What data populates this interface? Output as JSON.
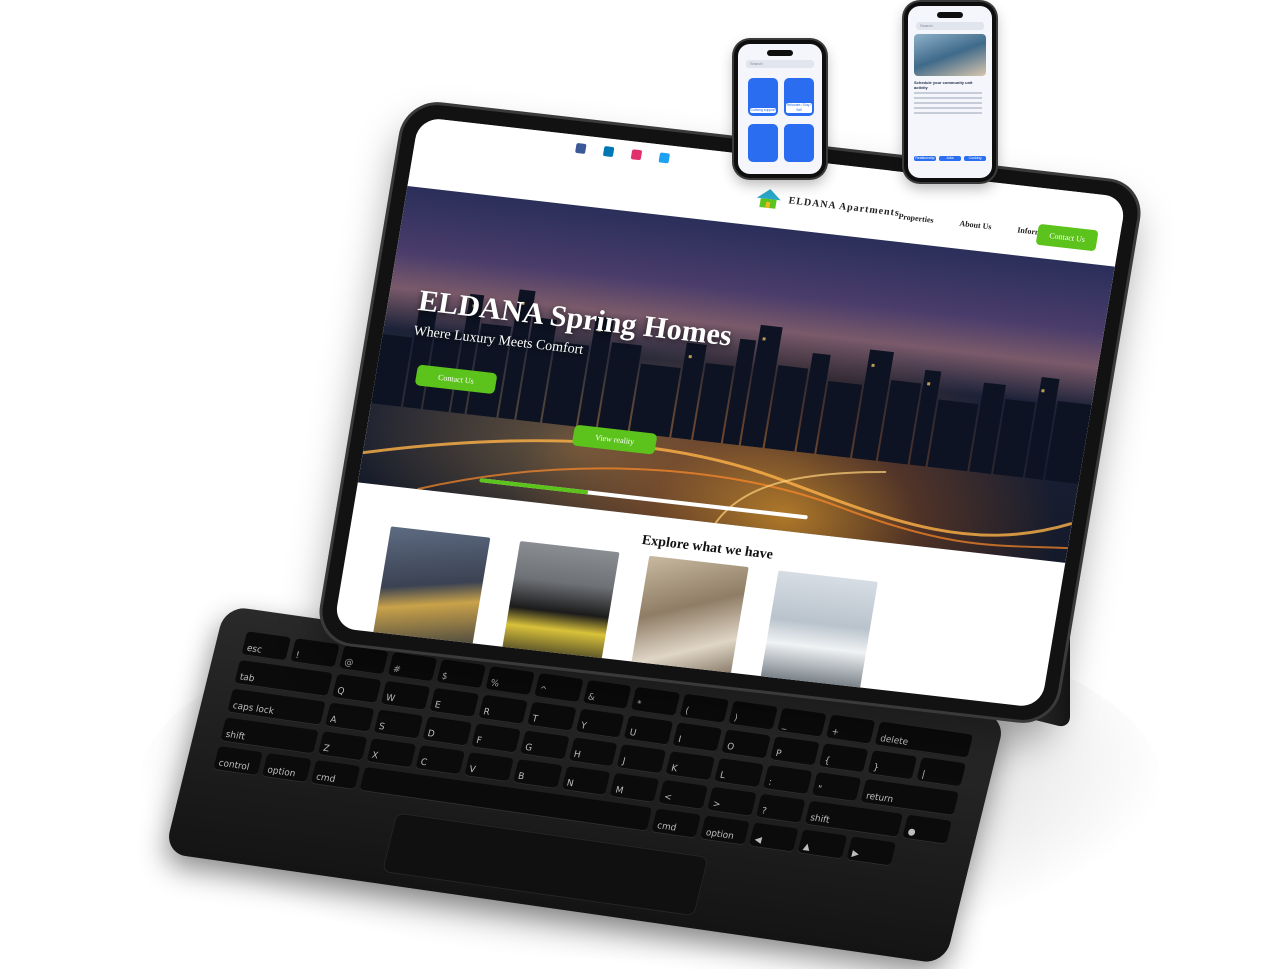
{
  "site": {
    "brand_name": "ELDANA Apartments",
    "nav": {
      "links": [
        "Properties",
        "About Us",
        "Information"
      ],
      "cta_label": "Contact Us"
    },
    "socials": [
      {
        "name": "facebook-icon",
        "color": "#3b5998"
      },
      {
        "name": "linkedin-icon",
        "color": "#0077b5"
      },
      {
        "name": "instagram-icon",
        "color": "#e1306c"
      },
      {
        "name": "twitter-icon",
        "color": "#1da1f2"
      }
    ],
    "hero": {
      "title": "ELDANA Spring Homes",
      "subtitle": "Where Luxury Meets Comfort",
      "primary_cta": "Contact Us",
      "secondary_cta": "View reality",
      "slider_progress": 0.33
    },
    "section": {
      "title": "Explore what we have"
    }
  },
  "colors": {
    "accent": "#5cc21c",
    "phone_accent": "#2a6df0"
  },
  "phones": {
    "left": {
      "search_placeholder": "Search",
      "cards": [
        "Coliving support",
        "Relocate / Buy / Sell"
      ]
    },
    "right": {
      "search_placeholder": "Search",
      "headline": "Schedule your community unit activity",
      "chips": [
        "Relationship",
        "Jobs",
        "Cooking"
      ]
    }
  }
}
